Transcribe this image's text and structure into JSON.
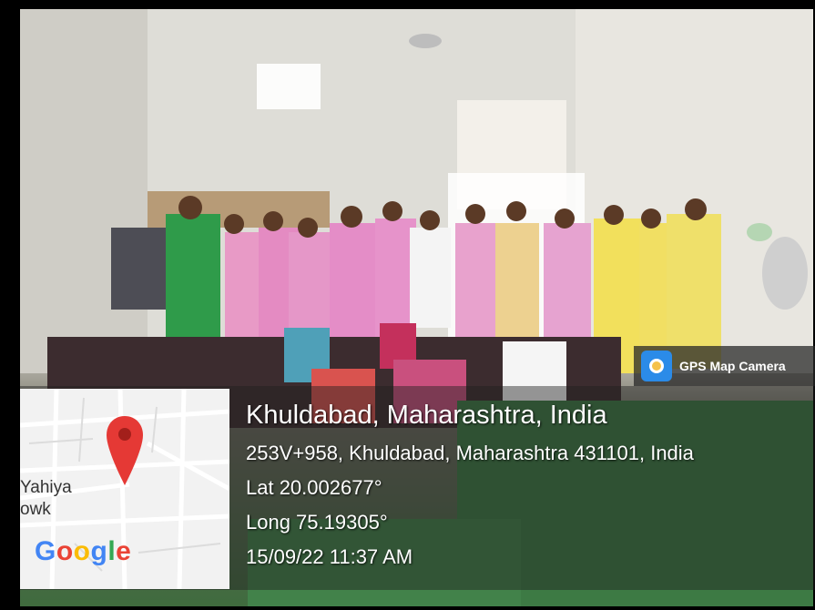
{
  "badge": {
    "text": "GPS Map Camera",
    "icon": "camera-pin-icon"
  },
  "location": {
    "title": "Khuldabad, Maharashtra, India",
    "address": "253V+958, Khuldabad, Maharashtra 431101, India",
    "lat": "Lat 20.002677°",
    "long": "Long 75.19305°",
    "datetime": "15/09/22 11:37 AM"
  },
  "map": {
    "label_top": "Yahiya",
    "label_bottom": "owk",
    "brand": "Google",
    "pin_color": "#e53935"
  }
}
